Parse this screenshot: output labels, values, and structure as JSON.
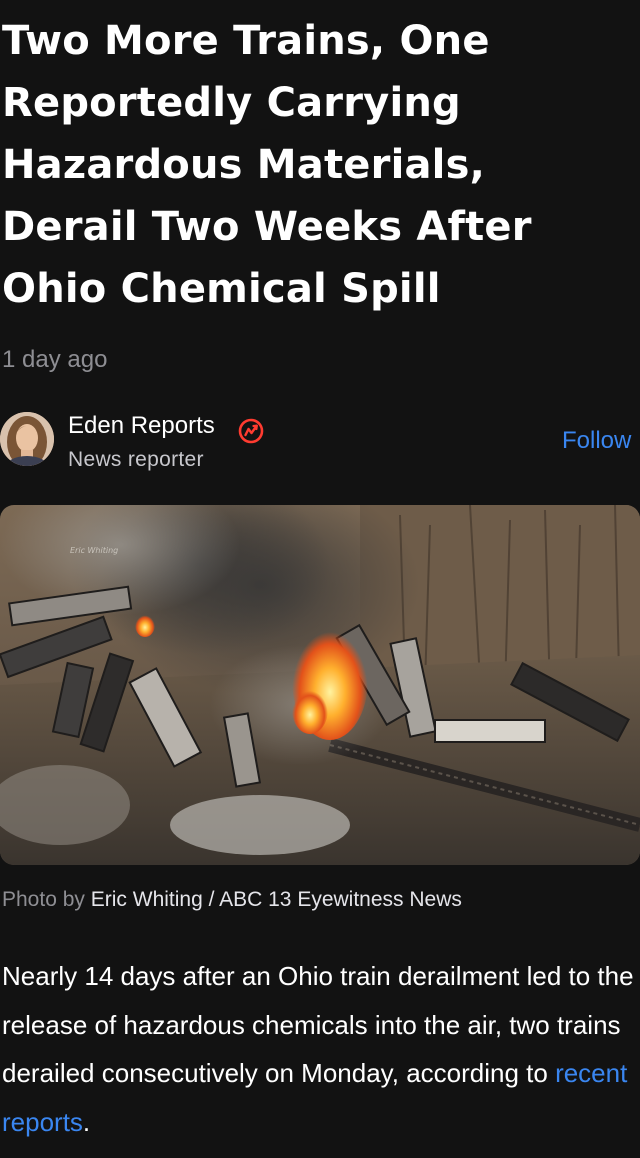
{
  "article": {
    "headline": "Two More Trains, One Reportedly Carrying Hazardous Materials, Derail Two Weeks After Ohio Chemical Spill",
    "timestamp": "1 day ago",
    "author": {
      "name": "Eden Reports",
      "role": "News reporter",
      "badge_icon": "news-badge-icon",
      "badge_color": "#ff3b30"
    },
    "follow_label": "Follow",
    "photo": {
      "watermark": "Eric Whiting"
    },
    "caption": {
      "prefix": "Photo by",
      "credit": "Eric Whiting / ABC 13 Eyewitness News"
    },
    "body": {
      "text_before_link": "Nearly 14 days after an Ohio train derailment led to the release of hazardous chemicals into the air, two trains derailed consecutively on Monday, according to ",
      "link_text": "recent reports",
      "text_after_link": "."
    }
  },
  "colors": {
    "background": "#121212",
    "link": "#3a86f0",
    "muted": "#8e8e93"
  }
}
